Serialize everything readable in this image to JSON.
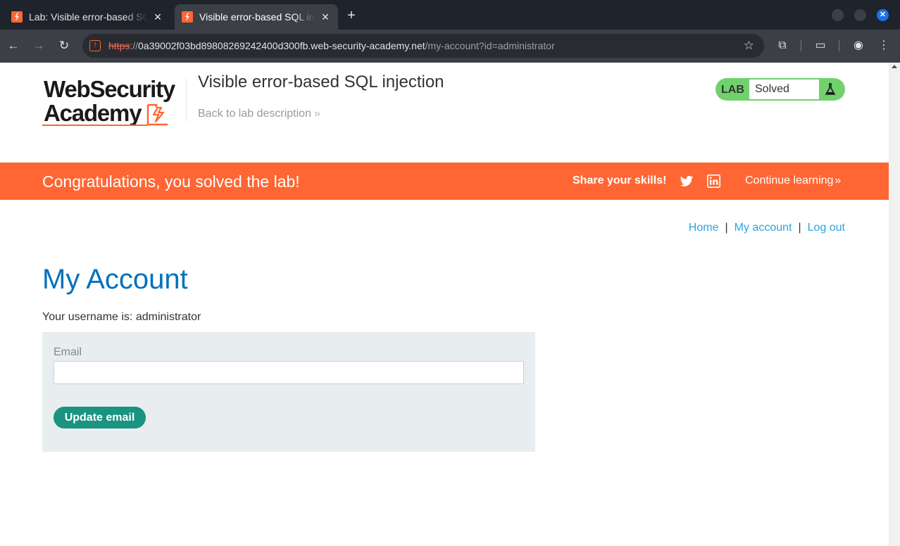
{
  "browser": {
    "tabs": [
      {
        "title": "Lab: Visible error-based SQL injection",
        "active": false
      },
      {
        "title": "Visible error-based SQL injection",
        "active": true
      }
    ],
    "url_scheme": "https",
    "url_sep": "://",
    "url_host": "0a39002f03bd89808269242400d300fb.web-security-academy.net",
    "url_path": "/my-account?id=administrator",
    "accent_color": "#1a73e8"
  },
  "header": {
    "logo_line1": "WebSecurity",
    "logo_line2": "Academy",
    "lab_title": "Visible error-based SQL injection",
    "back_link": "Back to lab description",
    "lab_label": "LAB",
    "lab_status": "Solved",
    "status_color": "#70d16d"
  },
  "banner": {
    "message": "Congratulations, you solved the lab!",
    "share_label": "Share your skills!",
    "continue_link": "Continue learning",
    "color": "#ff6633"
  },
  "nav": {
    "home": "Home",
    "separator": "|",
    "my_account": "My account",
    "log_out": "Log out"
  },
  "main": {
    "title": "My Account",
    "username_line": "Your username is: administrator",
    "email_label": "Email",
    "email_value": "",
    "update_button": "Update email"
  }
}
